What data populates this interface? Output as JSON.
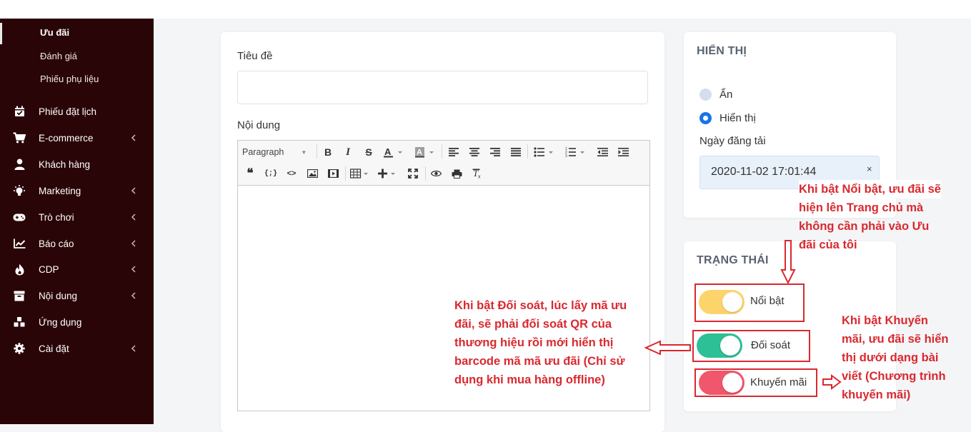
{
  "sidebar": {
    "sub_items": [
      "Ưu đãi",
      "Đánh giá",
      "Phiếu phụ liệu"
    ],
    "items": [
      {
        "label": "Phiếu đặt lịch",
        "icon": "calendar-check-icon",
        "has_submenu": false
      },
      {
        "label": "E-commerce",
        "icon": "cart-icon",
        "has_submenu": true
      },
      {
        "label": "Khách hàng",
        "icon": "user-icon",
        "has_submenu": false
      },
      {
        "label": "Marketing",
        "icon": "bulb-icon",
        "has_submenu": true
      },
      {
        "label": "Trò chơi",
        "icon": "gamepad-icon",
        "has_submenu": true
      },
      {
        "label": "Báo cáo",
        "icon": "chart-line-icon",
        "has_submenu": true
      },
      {
        "label": "CDP",
        "icon": "fire-icon",
        "has_submenu": true
      },
      {
        "label": "Nội dung",
        "icon": "archive-icon",
        "has_submenu": true
      },
      {
        "label": "Ứng dụng",
        "icon": "cubes-icon",
        "has_submenu": false
      },
      {
        "label": "Cài đặt",
        "icon": "gear-icon",
        "has_submenu": true
      }
    ]
  },
  "form": {
    "title_label": "Tiêu đề",
    "title_value": "",
    "content_label": "Nội dung",
    "format_select": "Paragraph"
  },
  "display": {
    "title": "HIỂN THỊ",
    "options": [
      "Ẩn",
      "Hiển thị"
    ],
    "selected": "Hiển thị",
    "date_label": "Ngày đăng tải",
    "date_value": "2020-11-02 17:01:44",
    "clear_symbol": "×"
  },
  "status": {
    "title": "TRẠNG THÁI",
    "toggles": [
      {
        "label": "Nổi bật",
        "on": true,
        "color": "#fdd46b"
      },
      {
        "label": "Đối soát",
        "on": true,
        "color": "#2dbf96"
      },
      {
        "label": "Khuyến mãi",
        "on": true,
        "color": "#f0566c"
      }
    ]
  },
  "annotations": {
    "featured": [
      "Khi bật Nổi bật, ưu đãi sẽ",
      "hiện lên Trang chủ mà",
      "không cần phải vào Ưu",
      "đãi của tôi"
    ],
    "reconcile": [
      "Khi bật Đối soát, lúc lấy mã ưu",
      "đãi, sẽ phải đối soát QR của",
      "thương hiệu rồi mới hiển thị",
      "barcode mã mã ưu đãi (Chỉ sử",
      "dụng khi mua hàng offline)"
    ],
    "promotion": [
      "Khi bật Khuyến",
      "mãi, ưu đãi sẽ hiển",
      "thị dưới dạng bài",
      "viết (Chương trình",
      "khuyến mãi)"
    ]
  },
  "colors": {
    "sidebar_bg": "#2a0508",
    "annotation_red": "#d9292f",
    "accent_blue": "#1a73e8"
  }
}
